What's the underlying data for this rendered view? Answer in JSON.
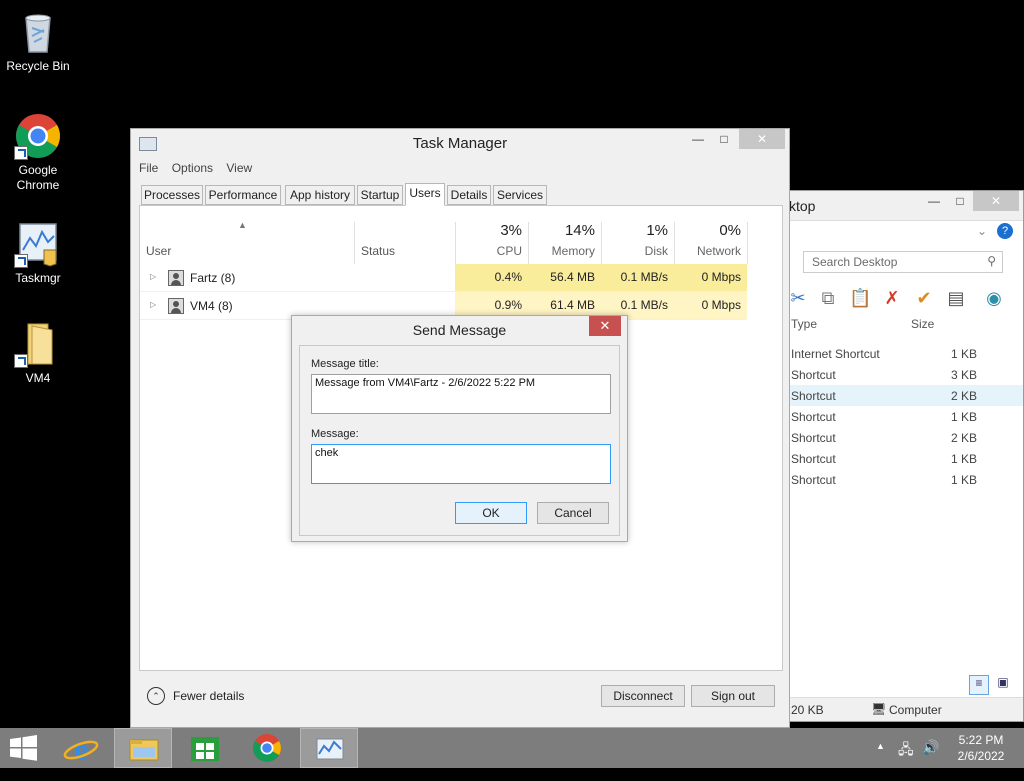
{
  "desktop": {
    "icons": [
      {
        "label": "Recycle Bin"
      },
      {
        "label": "Google Chrome"
      },
      {
        "label": "Taskmgr"
      },
      {
        "label": "VM4"
      }
    ]
  },
  "explorer": {
    "title": "ktop",
    "search_placeholder": "Search Desktop",
    "col_type": "Type",
    "col_size": "Size",
    "rows": [
      {
        "type": "Internet Shortcut",
        "size": "1 KB"
      },
      {
        "type": "Shortcut",
        "size": "3 KB"
      },
      {
        "type": "Shortcut",
        "size": "2 KB"
      },
      {
        "type": "Shortcut",
        "size": "1 KB"
      },
      {
        "type": "Shortcut",
        "size": "2 KB"
      },
      {
        "type": "Shortcut",
        "size": "1 KB"
      },
      {
        "type": "Shortcut",
        "size": "1 KB"
      }
    ],
    "status_size": "20 KB",
    "status_location": "Computer"
  },
  "taskmgr": {
    "title": "Task Manager",
    "menu": [
      "File",
      "Options",
      "View"
    ],
    "tabs": [
      "Processes",
      "Performance",
      "App history",
      "Startup",
      "Users",
      "Details",
      "Services"
    ],
    "active_tab": "Users",
    "columns": {
      "user": "User",
      "status": "Status",
      "cpu": {
        "pct": "3%",
        "label": "CPU"
      },
      "memory": {
        "pct": "14%",
        "label": "Memory"
      },
      "disk": {
        "pct": "1%",
        "label": "Disk"
      },
      "network": {
        "pct": "0%",
        "label": "Network"
      }
    },
    "users": [
      {
        "name": "Fartz (8)",
        "status": "",
        "cpu": "0.4%",
        "memory": "56.4 MB",
        "disk": "0.1 MB/s",
        "network": "0 Mbps"
      },
      {
        "name": "VM4 (8)",
        "status": "",
        "cpu": "0.9%",
        "memory": "61.4 MB",
        "disk": "0.1 MB/s",
        "network": "0 Mbps"
      }
    ],
    "fewer_details": "Fewer details",
    "disconnect": "Disconnect",
    "sign_out": "Sign out"
  },
  "send_message": {
    "title": "Send Message",
    "title_label": "Message title:",
    "title_value": "Message from VM4\\Fartz - 2/6/2022 5:22 PM",
    "message_label": "Message:",
    "message_value": "chek",
    "ok": "OK",
    "cancel": "Cancel"
  },
  "taskbar": {
    "time": "5:22 PM",
    "date": "2/6/2022"
  },
  "colors": {
    "heat_light": "#fff4c4",
    "heat_strong": "#f9ec9a",
    "taskbar": "#7d7d7d",
    "close_red": "#c75050"
  }
}
